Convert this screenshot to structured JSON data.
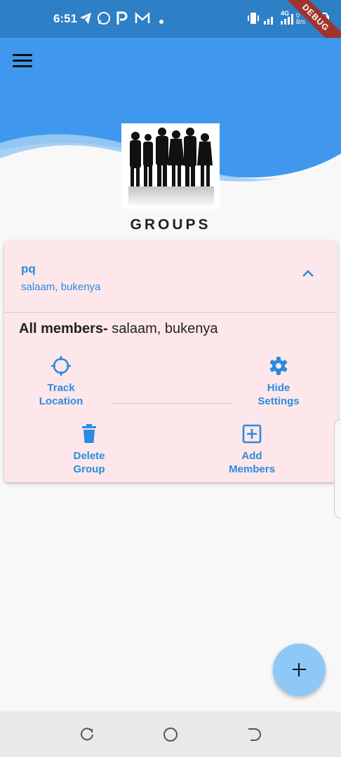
{
  "status_bar": {
    "time": "6:51",
    "debug_banner": "DEBUG",
    "network_label": "4G",
    "speed_label": "0 B/s",
    "icons": [
      "telegram-icon",
      "whatsapp-icon",
      "p-icon",
      "gmail-icon",
      "dot-icon",
      "vibrate-icon",
      "signal-icon",
      "battery-icon"
    ]
  },
  "header": {
    "menu_icon": "hamburger-menu-icon",
    "title": "GROUPS"
  },
  "group": {
    "name": "pq",
    "members_summary": "salaam, bukenya",
    "all_members_label": "All members-",
    "all_members_value": " salaam, bukenya",
    "actions": {
      "track_line1": "Track",
      "track_line2": "Location",
      "hide_line1": "Hide",
      "hide_line2": "Settings",
      "delete_line1": "Delete",
      "delete_line2": "Group",
      "add_line1": "Add",
      "add_line2": "Members"
    }
  },
  "colors": {
    "accent": "#2b8be0",
    "header_blue": "#3f98ee",
    "card_bg": "#fde7ea",
    "fab": "#8ec8f6"
  }
}
